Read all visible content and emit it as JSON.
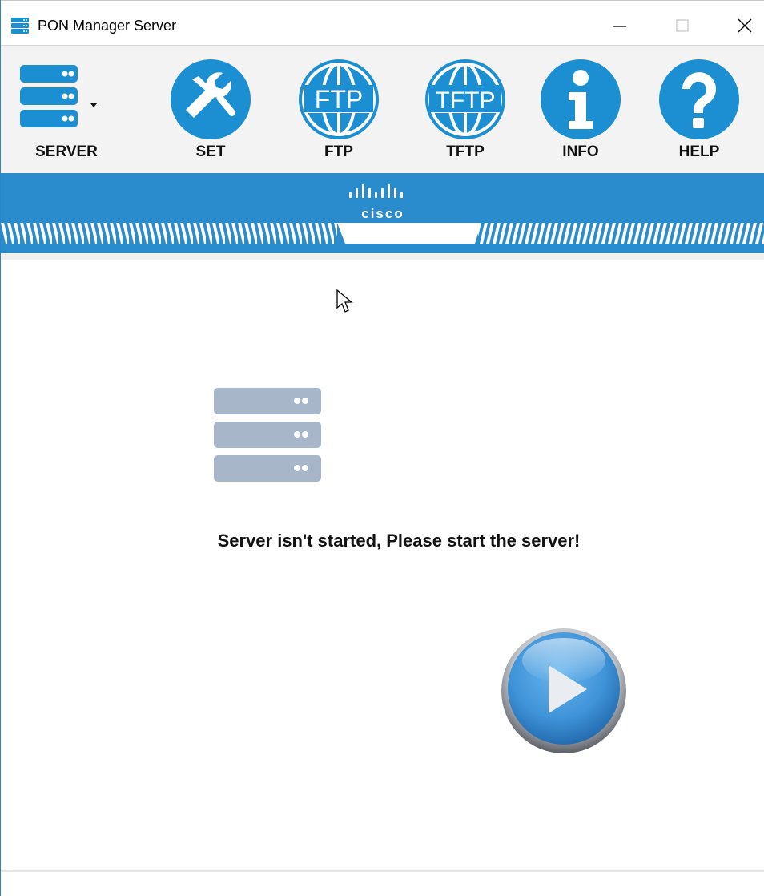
{
  "window": {
    "title": "PON Manager Server",
    "controls": {
      "minimize_icon": "minimize-icon",
      "maximize_icon": "maximize-icon",
      "close_icon": "close-icon"
    }
  },
  "toolbar": {
    "items": [
      {
        "label": "SERVER",
        "icon": "server-stack-icon",
        "has_dropdown": true
      },
      {
        "label": "SET",
        "icon": "tools-icon"
      },
      {
        "label": "FTP",
        "icon": "globe-ftp-icon",
        "icon_text": "FTP"
      },
      {
        "label": "TFTP",
        "icon": "globe-tftp-icon",
        "icon_text": "TFTP"
      },
      {
        "label": "INFO",
        "icon": "info-icon"
      },
      {
        "label": "HELP",
        "icon": "help-icon"
      }
    ]
  },
  "banner": {
    "brand": "cisco",
    "logo_icon": "cisco-bars-icon"
  },
  "main": {
    "status_message": "Server isn't started, Please start the server!",
    "server_icon": "server-stack-icon",
    "start_button_icon": "play-icon"
  },
  "colors": {
    "accent": "#2a8ccd",
    "icon_blue": "#1b8fd2",
    "server_gray": "#a7b7c9",
    "play_blue": "#3f93d8"
  }
}
